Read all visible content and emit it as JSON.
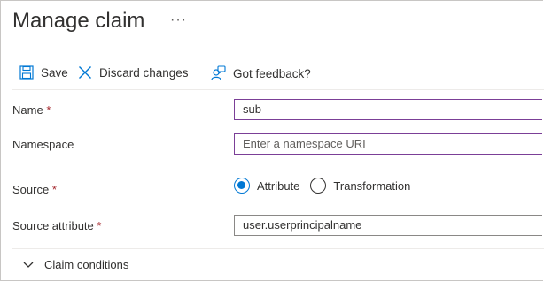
{
  "header": {
    "title": "Manage claim",
    "more": "···"
  },
  "toolbar": {
    "save_label": "Save",
    "discard_label": "Discard changes",
    "feedback_label": "Got feedback?"
  },
  "form": {
    "name": {
      "label": "Name",
      "required": "*",
      "value": "sub"
    },
    "namespace": {
      "label": "Namespace",
      "placeholder": "Enter a namespace URI"
    },
    "source": {
      "label": "Source",
      "required": "*",
      "options": [
        "Attribute",
        "Transformation"
      ],
      "selected": "Attribute"
    },
    "source_attribute": {
      "label": "Source attribute",
      "required": "*",
      "value": "user.userprincipalname"
    }
  },
  "claim_conditions": {
    "label": "Claim conditions"
  },
  "colors": {
    "accent": "#0078d4",
    "focus_border": "#7b3f97",
    "required": "#a4262c"
  },
  "icons": [
    "save-icon",
    "close-icon",
    "feedback-icon",
    "chevron-down-icon"
  ]
}
